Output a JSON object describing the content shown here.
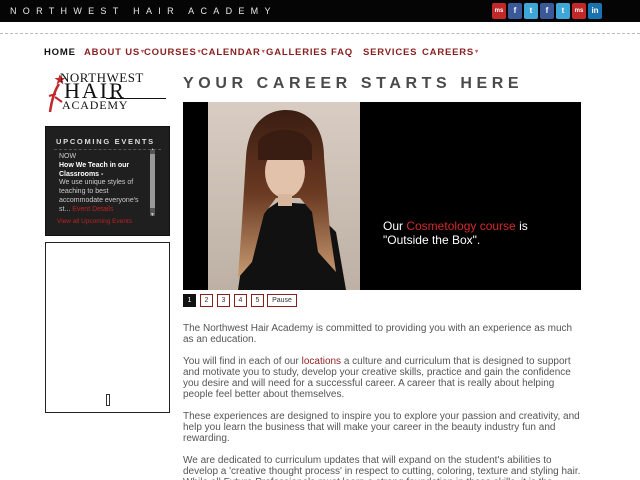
{
  "topbar": {
    "site_title": "NORTHWEST HAIR ACADEMY",
    "social": [
      {
        "icon": "myspace-icon",
        "label": "ms"
      },
      {
        "icon": "facebook-icon",
        "label": "f"
      },
      {
        "icon": "twitter-icon",
        "label": "t"
      },
      {
        "icon": "facebook-icon",
        "label": "f"
      },
      {
        "icon": "twitter-icon",
        "label": "t"
      },
      {
        "icon": "myspace-icon",
        "label": "ms"
      },
      {
        "icon": "linkedin-icon",
        "label": "in"
      }
    ]
  },
  "nav": {
    "home": "HOME",
    "about": "ABOUT US",
    "courses": "COURSES",
    "calendar": "CALENDAR",
    "galleries": "GALLERIES",
    "faq": "FAQ",
    "services": "SERVICES",
    "careers": "CAREERS",
    "caret": "▾"
  },
  "logo": {
    "line1": "NORTHWEST",
    "line2": "HAIR",
    "line3": "ACADEMY"
  },
  "events": {
    "title": "UPCOMING EVENTS",
    "now": "NOW",
    "headline": "How We Teach in our Classrooms -",
    "desc": "We use unique styles of teaching to best accommodate everyone's st...",
    "more": "Event Details",
    "view_all": "View all Upcoming Events"
  },
  "main": {
    "heading": "YOUR CAREER STARTS HERE",
    "caption_pre": "Our ",
    "caption_link": "Cosmetology course",
    "caption_post": " is \"Outside the Box\".",
    "pager": [
      "1",
      "2",
      "3",
      "4",
      "5"
    ],
    "pause": "Pause",
    "para1": "The Northwest Hair Academy is committed to providing you with an experience as much as an education.",
    "para2_pre": "You will find in each of our ",
    "para2_link": "locations",
    "para2_post": " a culture and curriculum that is designed to support and motivate you to study, develop your creative skills, practice and gain the confidence you desire and will need for a successful career. A career that is really about helping people feel better about themselves.",
    "para3": "These experiences are designed to inspire you to explore your passion and creativity, and help you learn the business that will make your career in the beauty industry fun and rewarding.",
    "para4": "We are dedicated to curriculum updates that will expand on the student's abilities to develop a 'creative thought process' in respect to cutting, coloring, texture and styling hair.  While all Future Professionals must learn a strong foundation in these skills, it is the"
  }
}
